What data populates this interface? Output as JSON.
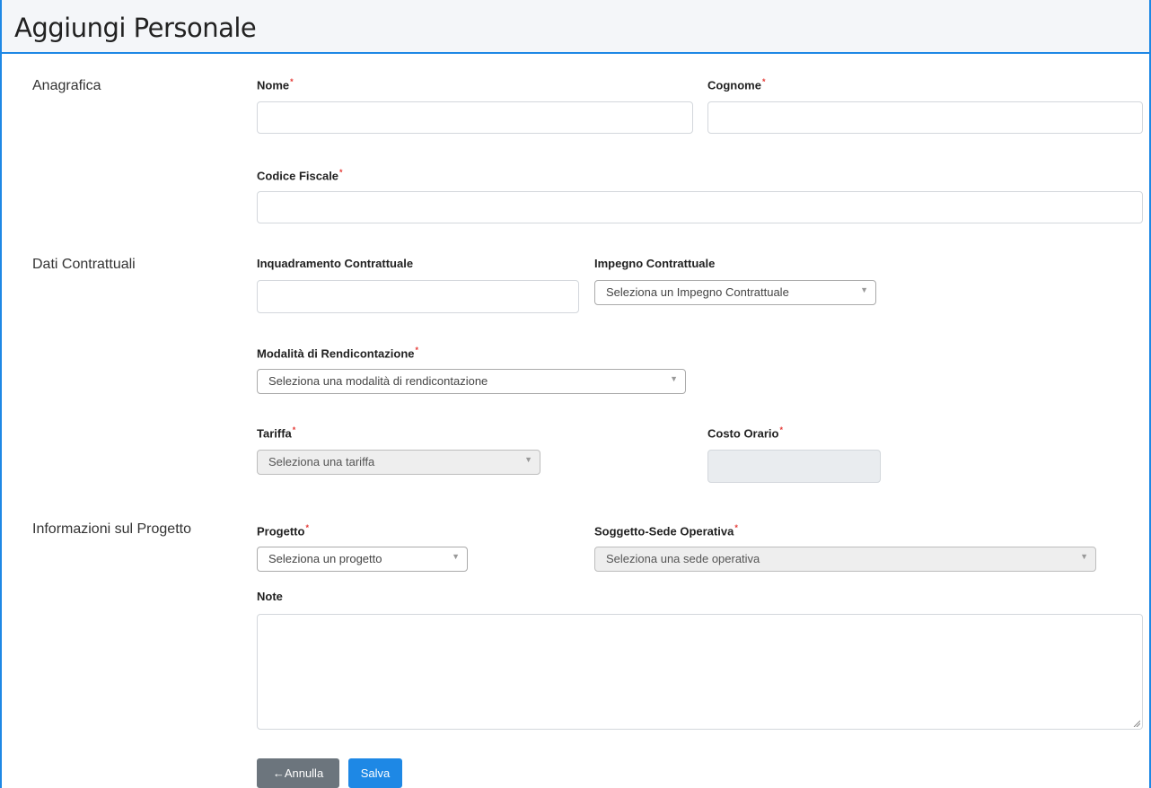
{
  "page": {
    "title": "Aggiungi Personale"
  },
  "sections": {
    "anagrafica": "Anagrafica",
    "dati_contrattuali": "Dati Contrattuali",
    "informazioni_progetto": "Informazioni sul Progetto"
  },
  "fields": {
    "nome": {
      "label": "Nome",
      "required_mark": "*",
      "value": ""
    },
    "cognome": {
      "label": "Cognome",
      "required_mark": "*",
      "value": ""
    },
    "codice_fiscale": {
      "label": "Codice Fiscale",
      "required_mark": "*",
      "value": ""
    },
    "inquadramento": {
      "label": "Inquadramento Contrattuale",
      "value": ""
    },
    "impegno": {
      "label": "Impegno Contrattuale",
      "selected": "Seleziona un Impegno Contrattuale"
    },
    "modalita": {
      "label": "Modalità di Rendicontazione",
      "required_mark": "*",
      "selected": "Seleziona una modalità di rendicontazione"
    },
    "tariffa": {
      "label": "Tariffa",
      "required_mark": "*",
      "selected": "Seleziona una tariffa"
    },
    "costo_orario": {
      "label": "Costo Orario",
      "required_mark": "*",
      "value": ""
    },
    "progetto": {
      "label": "Progetto",
      "required_mark": "*",
      "selected": "Seleziona un progetto"
    },
    "sede": {
      "label": "Soggetto-Sede Operativa",
      "required_mark": "*",
      "selected": "Seleziona una sede operativa"
    },
    "note": {
      "label": "Note",
      "value": ""
    }
  },
  "buttons": {
    "annulla": {
      "icon": "arrow-left-icon",
      "label": "Annulla"
    },
    "salva": {
      "label": "Salva"
    }
  },
  "icons": {
    "dropdown": "chevron-down-icon",
    "annulla_glyph": "←",
    "caret_glyph": "▼"
  },
  "colors": {
    "accent": "#1e88e5",
    "required": "#e53935",
    "secondary_button": "#6c757d"
  }
}
